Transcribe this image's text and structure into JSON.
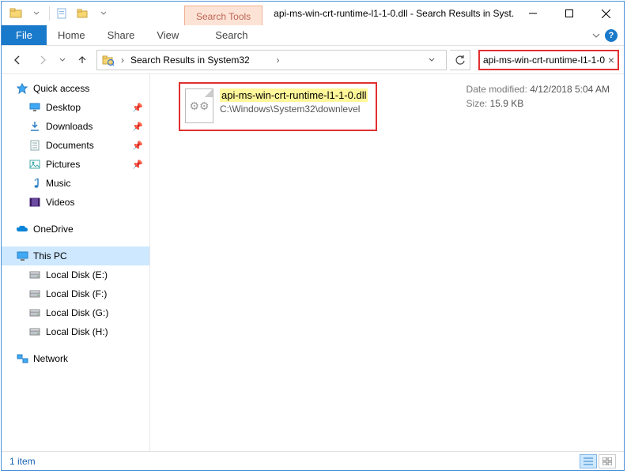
{
  "window": {
    "search_tools_label": "Search Tools",
    "title": "api-ms-win-crt-runtime-l1-1-0.dll - Search Results in Syst..."
  },
  "ribbon": {
    "file": "File",
    "tabs": [
      "Home",
      "Share",
      "View"
    ],
    "search_tab": "Search"
  },
  "nav": {
    "breadcrumb_prefix": "Search Results in System32",
    "search_text": "api-ms-win-crt-runtime-l1-1-0."
  },
  "sidebar": {
    "quick_access": "Quick access",
    "quick_items": [
      {
        "label": "Desktop",
        "icon": "desktop",
        "pinned": true
      },
      {
        "label": "Downloads",
        "icon": "download",
        "pinned": true
      },
      {
        "label": "Documents",
        "icon": "document",
        "pinned": true
      },
      {
        "label": "Pictures",
        "icon": "picture",
        "pinned": true
      },
      {
        "label": "Music",
        "icon": "music",
        "pinned": false
      },
      {
        "label": "Videos",
        "icon": "video",
        "pinned": false
      }
    ],
    "onedrive": "OneDrive",
    "this_pc": "This PC",
    "drives": [
      {
        "label": "Local Disk (E:)"
      },
      {
        "label": "Local Disk (F:)"
      },
      {
        "label": "Local Disk (G:)"
      },
      {
        "label": "Local Disk (H:)"
      }
    ],
    "network": "Network"
  },
  "result": {
    "filename": "api-ms-win-crt-runtime-l1-1-0.dll",
    "path": "C:\\Windows\\System32\\downlevel",
    "date_label": "Date modified:",
    "date_value": "4/12/2018 5:04 AM",
    "size_label": "Size:",
    "size_value": "15.9 KB"
  },
  "status": {
    "count": "1 item"
  }
}
